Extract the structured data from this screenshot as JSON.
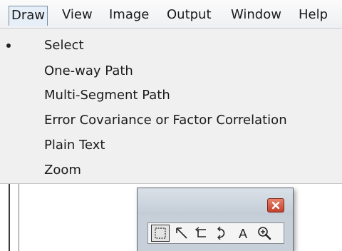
{
  "menubar": {
    "items": [
      {
        "label": "Draw",
        "open": true
      },
      {
        "label": "View"
      },
      {
        "label": "Image"
      },
      {
        "label": "Output"
      },
      {
        "label": "Window"
      },
      {
        "label": "Help"
      }
    ]
  },
  "dropdown": {
    "items": [
      {
        "label": "Select",
        "checked": true
      },
      {
        "label": "One-way Path"
      },
      {
        "label": "Multi-Segment Path"
      },
      {
        "label": "Error Covariance or Factor Correlation"
      },
      {
        "label": "Plain Text"
      },
      {
        "label": "Zoom"
      }
    ]
  },
  "toolbox": {
    "tools": [
      {
        "icon": "select-rectangle-icon",
        "selected": true
      },
      {
        "icon": "arrow-icon"
      },
      {
        "icon": "multi-segment-path-icon"
      },
      {
        "icon": "covariance-curve-icon"
      },
      {
        "icon": "text-icon",
        "glyph": "A"
      },
      {
        "icon": "zoom-icon"
      }
    ]
  },
  "colors": {
    "menu_open_bg": "#e6eef8",
    "dropdown_bg": "#f0f0f0",
    "toolbox_bg": "#c7cfd9",
    "close_button": "#c2412b"
  }
}
